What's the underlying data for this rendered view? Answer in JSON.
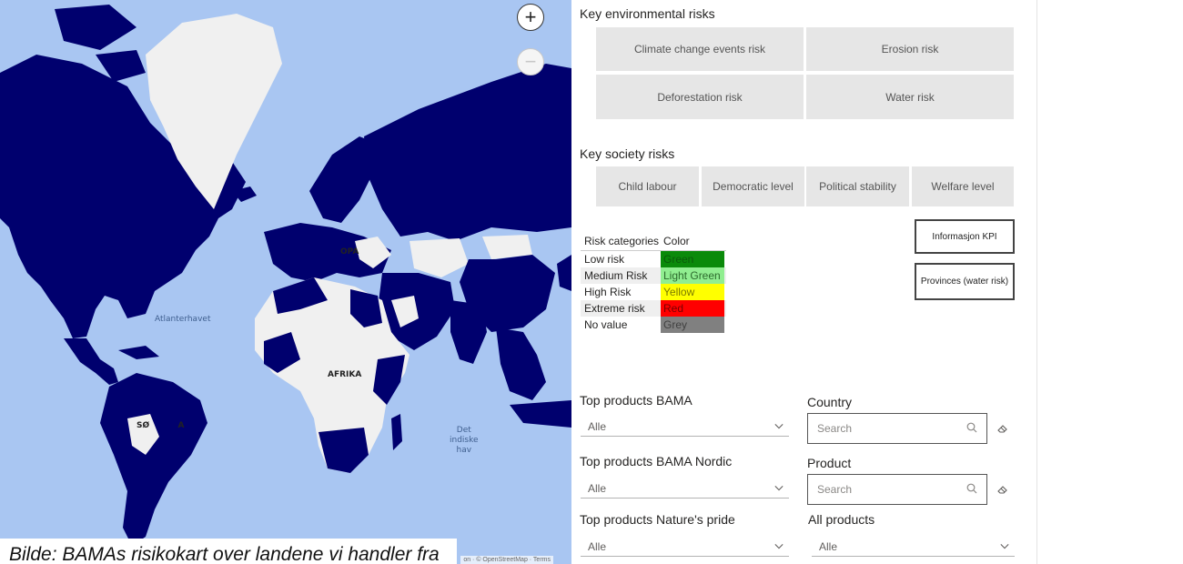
{
  "map": {
    "labels": {
      "ocean_atlantic": "Atlanterhavet",
      "ocean_indian": "Det\nindiske\nhav",
      "continent_europe": "OPA",
      "continent_africa": "AFRIKA",
      "continent_south_america": "SØ          A"
    },
    "attribution": "on · © OpenStreetMap · Terms",
    "zoom_in": "+",
    "zoom_out": "−",
    "caption": "Bilde: BAMAs risikokart over landene vi handler fra",
    "colors": {
      "ocean": "#a9c6f2",
      "highlight": "#00006e",
      "other": "#f0f0f0"
    }
  },
  "environment": {
    "title": "Key environmental risks",
    "tiles": [
      "Climate change events risk",
      "Erosion risk",
      "Deforestation risk",
      "Water risk"
    ]
  },
  "society": {
    "title": "Key society risks",
    "tiles": [
      "Child labour",
      "Democratic level",
      "Political stability",
      "Welfare level"
    ]
  },
  "legend": {
    "headers": [
      "Risk categories",
      "Color"
    ],
    "rows": [
      {
        "category": "Low risk",
        "color_name": "Green",
        "color": "#0a8a0a",
        "text_color": "#0a5a0a"
      },
      {
        "category": "Medium Risk",
        "color_name": "Light Green",
        "color": "#90ee90",
        "text_color": "#2d6b2d"
      },
      {
        "category": "High Risk",
        "color_name": "Yellow",
        "color": "#ffff00",
        "text_color": "#7a7a00"
      },
      {
        "category": "Extreme risk",
        "color_name": "Red",
        "color": "#ff0000",
        "text_color": "#7a0000"
      },
      {
        "category": "No value",
        "color_name": "Grey",
        "color": "#808080",
        "text_color": "#404040"
      }
    ]
  },
  "buttons": {
    "info_kpi": "Informasjon KPI",
    "provinces": "Provinces (water risk)"
  },
  "slicers": {
    "top_bama": {
      "title": "Top products BAMA",
      "value": "Alle"
    },
    "top_bama_nordic": {
      "title": "Top products BAMA Nordic",
      "value": "Alle"
    },
    "top_natures_pride": {
      "title": "Top products Nature's pride",
      "value": "Alle"
    },
    "country": {
      "title": "Country",
      "placeholder": "Search"
    },
    "product": {
      "title": "Product",
      "placeholder": "Search"
    },
    "all_products": {
      "title": "All products",
      "value": "Alle"
    }
  }
}
